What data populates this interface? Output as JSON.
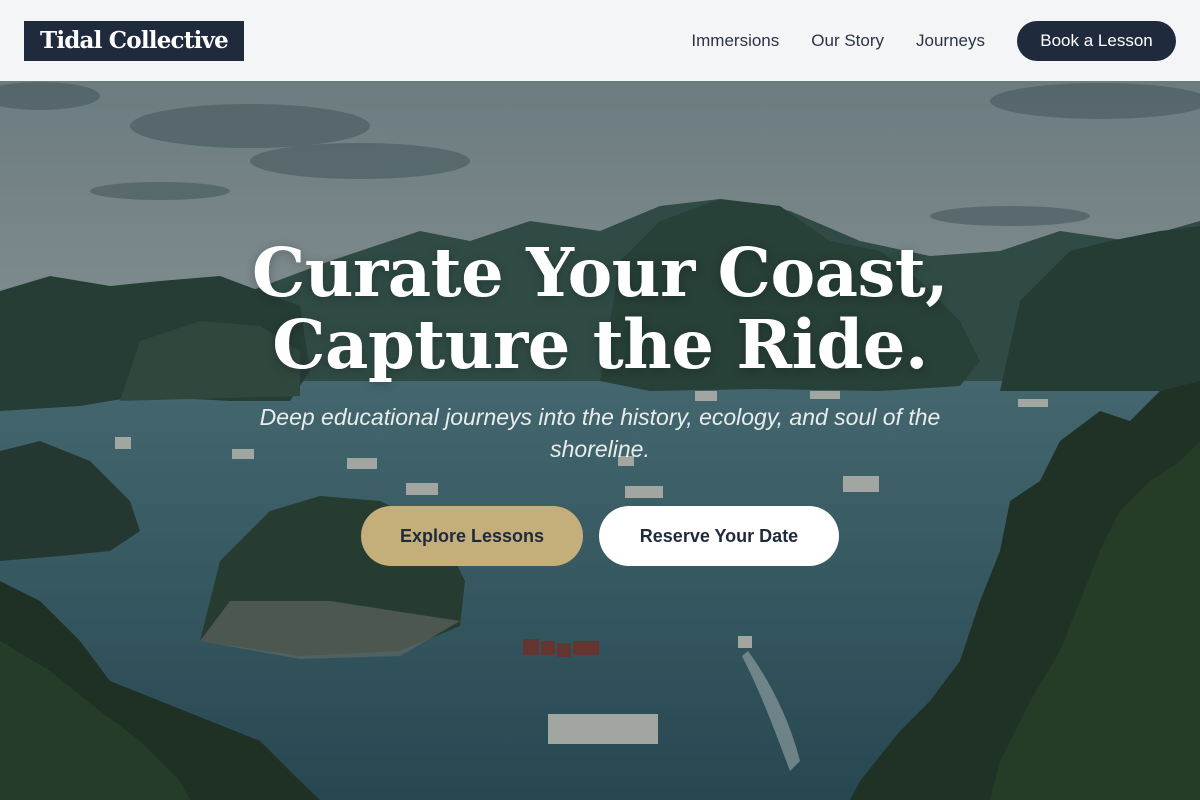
{
  "header": {
    "logo": "Tidal Collective",
    "nav": [
      {
        "label": "Immersions"
      },
      {
        "label": "Our Story"
      },
      {
        "label": "Journeys"
      }
    ],
    "cta_label": "Book a Lesson"
  },
  "hero": {
    "headline_line1": "Curate Your Coast,",
    "headline_line2": "Capture the Ride.",
    "subhead": "Deep educational journeys into the history, ecology, and soul of the shoreline.",
    "primary_cta": "Explore Lessons",
    "secondary_cta": "Reserve Your Date",
    "background_image": "bay-with-limestone-islands-and-boats"
  },
  "colors": {
    "navy": "#1f2a3c",
    "gold": "#c4ae7a",
    "header_bg": "#f4f5f6",
    "water": "#3f6f79"
  }
}
